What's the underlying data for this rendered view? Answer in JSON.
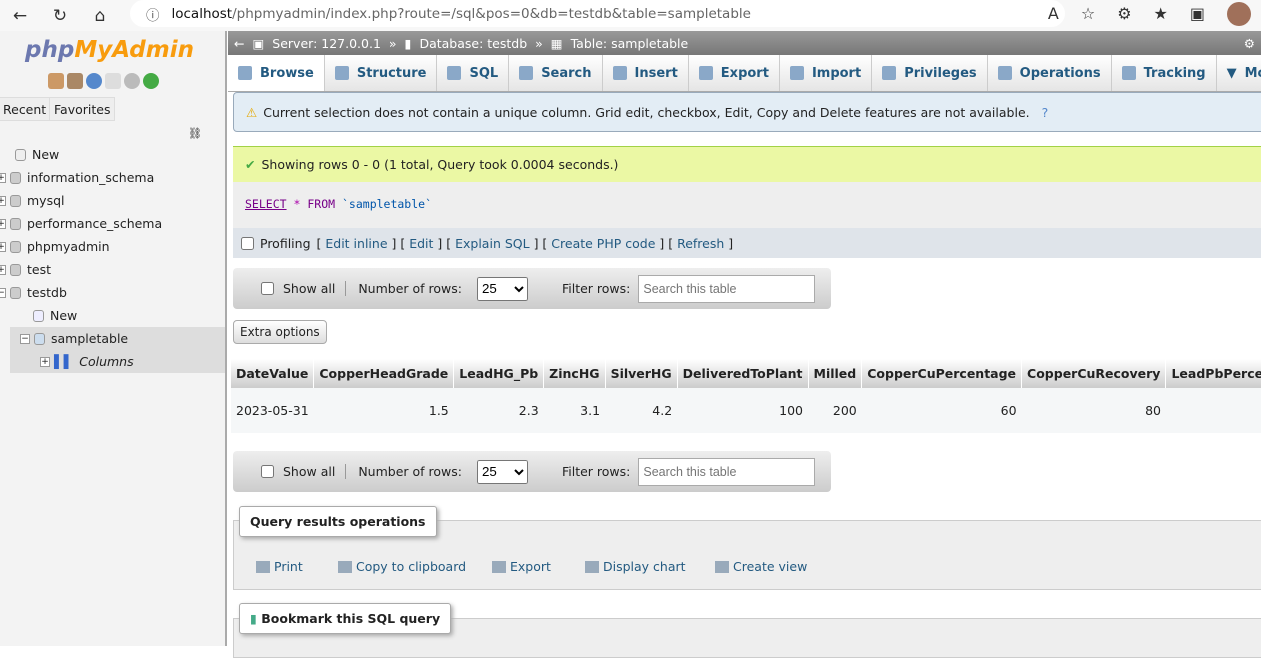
{
  "browser": {
    "url_host": "localhost",
    "url_path": "/phpmyadmin/index.php?route=/sql&pos=0&db=testdb&table=sampletable"
  },
  "sidebar": {
    "logo_php": "php",
    "logo_myadmin": "MyAdmin",
    "recent": "Recent",
    "favorites": "Favorites",
    "tree": [
      {
        "label": "New"
      },
      {
        "label": "information_schema"
      },
      {
        "label": "mysql"
      },
      {
        "label": "performance_schema"
      },
      {
        "label": "phpmyadmin"
      },
      {
        "label": "test"
      },
      {
        "label": "testdb"
      },
      {
        "label": "New"
      },
      {
        "label": "sampletable"
      },
      {
        "label": "Columns"
      }
    ]
  },
  "breadcrumb": {
    "server": "Server: 127.0.0.1",
    "database": "Database: testdb",
    "table": "Table: sampletable",
    "sep": "»"
  },
  "tabs": [
    "Browse",
    "Structure",
    "SQL",
    "Search",
    "Insert",
    "Export",
    "Import",
    "Privileges",
    "Operations",
    "Tracking",
    "More"
  ],
  "notice": "Current selection does not contain a unique column. Grid edit, checkbox, Edit, Copy and Delete features are not available.",
  "success": "Showing rows 0 - 0 (1 total, Query took 0.0004 seconds.)",
  "sql": {
    "select": "SELECT",
    "star": "*",
    "from": "FROM",
    "table": "`sampletable`"
  },
  "profiling": {
    "label": "Profiling",
    "links": [
      "Edit inline",
      "Edit",
      "Explain SQL",
      "Create PHP code",
      "Refresh"
    ]
  },
  "nav": {
    "show_all": "Show all",
    "rows_label": "Number of rows:",
    "rows_value": "25",
    "filter_label": "Filter rows:",
    "filter_placeholder": "Search this table"
  },
  "extra_options": "Extra options",
  "table": {
    "headers": [
      "DateValue",
      "CopperHeadGrade",
      "LeadHG_Pb",
      "ZincHG",
      "SilverHG",
      "DeliveredToPlant",
      "Milled",
      "CopperCuPercentage",
      "CopperCuRecovery",
      "LeadPbPercen"
    ],
    "rows": [
      [
        "2023-05-31",
        "1.5",
        "2.3",
        "3.1",
        "4.2",
        "100",
        "200",
        "60",
        "80",
        ""
      ]
    ]
  },
  "query_ops": {
    "title": "Query results operations",
    "items": [
      "Print",
      "Copy to clipboard",
      "Export",
      "Display chart",
      "Create view"
    ]
  },
  "bookmark": "Bookmark this SQL query"
}
